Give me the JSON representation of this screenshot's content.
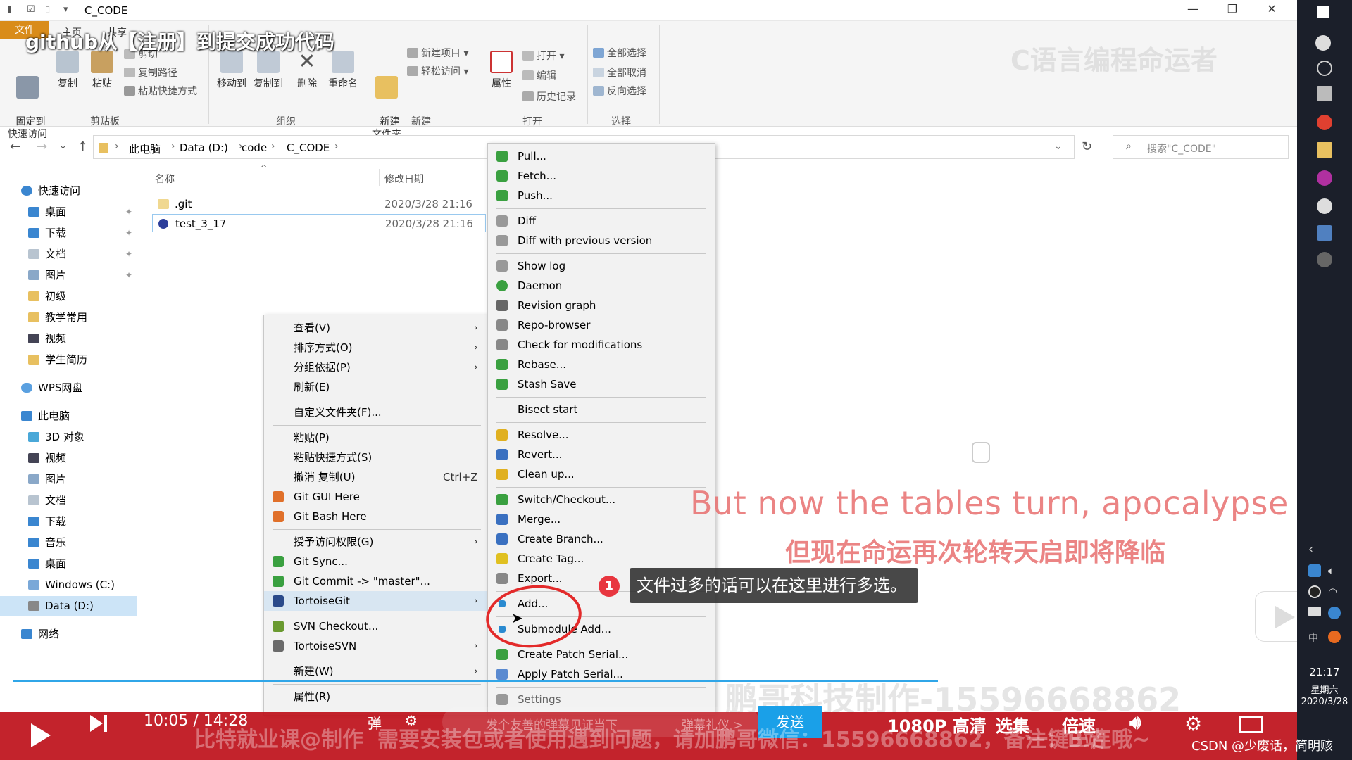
{
  "window": {
    "title": "C_CODE"
  },
  "video": {
    "title": "github从【注册】到提交成功代码",
    "watermark": "C语言编程命运者",
    "bg_watermark": "鹏哥科技制作-15596668862"
  },
  "ribbon": {
    "tabs": [
      "文件",
      "主页",
      "共享",
      "查看"
    ],
    "clipboard": {
      "pin": "固定到\n快速访问",
      "copy": "复制",
      "paste": "粘贴",
      "cut": "剪切",
      "copy_path": "复制路径",
      "paste_shortcut": "粘贴快捷方式",
      "label": "剪贴板"
    },
    "organize": {
      "move_to": "移动到",
      "copy_to": "复制到",
      "delete": "删除",
      "rename": "重命名",
      "label": "组织"
    },
    "new": {
      "new_folder": "新建\n文件夹",
      "new_item": "新建项目",
      "easy_access": "轻松访问",
      "label": "新建"
    },
    "open": {
      "properties": "属性",
      "open": "打开",
      "edit": "编辑",
      "history": "历史记录",
      "label": "打开"
    },
    "select": {
      "select_all": "全部选择",
      "select_none": "全部取消",
      "invert": "反向选择",
      "label": "选择"
    }
  },
  "address": {
    "crumbs": [
      "此电脑",
      "Data (D:)",
      "code",
      "C_CODE"
    ],
    "search_placeholder": "搜索\"C_CODE\""
  },
  "nav_pane": {
    "quick_access": "快速访问",
    "quick_items": [
      "桌面",
      "下载",
      "文档",
      "图片",
      "初级",
      "教学常用",
      "视频",
      "学生简历"
    ],
    "wps": "WPS网盘",
    "this_pc": "此电脑",
    "pc_items": [
      "3D 对象",
      "视频",
      "图片",
      "文档",
      "下载",
      "音乐",
      "桌面",
      "Windows (C:)",
      "Data (D:)"
    ],
    "network": "网络"
  },
  "file_list": {
    "col_name": "名称",
    "col_date": "修改日期",
    "rows": [
      {
        "name": ".git",
        "date": "2020/3/28 21:16"
      },
      {
        "name": "test_3_17",
        "date": "2020/3/28 21:16"
      }
    ]
  },
  "context_menu": {
    "items": [
      {
        "label": "查看(V)"
      },
      {
        "label": "排序方式(O)"
      },
      {
        "label": "分组依据(P)"
      },
      {
        "label": "刷新(E)"
      },
      {
        "label": "自定义文件夹(F)..."
      },
      {
        "label": "粘贴(P)"
      },
      {
        "label": "粘贴快捷方式(S)"
      },
      {
        "label": "撤消 复制(U)",
        "shortcut": "Ctrl+Z"
      },
      {
        "label": "Git GUI Here"
      },
      {
        "label": "Git Bash Here"
      },
      {
        "label": "授予访问权限(G)"
      },
      {
        "label": "Git Sync..."
      },
      {
        "label": "Git Commit -> \"master\"..."
      },
      {
        "label": "TortoiseGit"
      },
      {
        "label": "SVN Checkout..."
      },
      {
        "label": "TortoiseSVN"
      },
      {
        "label": "新建(W)"
      },
      {
        "label": "属性(R)"
      }
    ]
  },
  "tortoise_menu": {
    "items": [
      "Pull...",
      "Fetch...",
      "Push...",
      "Diff",
      "Diff with previous version",
      "Show log",
      "Daemon",
      "Revision graph",
      "Repo-browser",
      "Check for modifications",
      "Rebase...",
      "Stash Save",
      "Bisect start",
      "Resolve...",
      "Revert...",
      "Clean up...",
      "Switch/Checkout...",
      "Merge...",
      "Create Branch...",
      "Create Tag...",
      "Export...",
      "Add...",
      "Submodule Add...",
      "Create Patch Serial...",
      "Apply Patch Serial...",
      "Settings"
    ]
  },
  "subtitles": {
    "en": "But now the tables turn, apocalypse i",
    "zh": "但现在命运再次轮转天启即将降临"
  },
  "annotation": {
    "badge": "1",
    "text": "文件过多的话可以在这里进行多选。"
  },
  "taskbar": {
    "time": "21:17",
    "day": "星期六",
    "date": "2020/3/28"
  },
  "player": {
    "time": "10:05 / 14:28",
    "credit": "比特就业课@制作",
    "danmaku_placeholder": "发个友善的弹幕见证当下",
    "danmaku_etiquette": "弹幕礼仪 >",
    "send": "发送",
    "notice": "需要安装包或者使用遇到问题，请加鹏哥微信：15596668862，备注：B站",
    "quality": "1080P 高清",
    "episodes": "选集",
    "speed": "倍速",
    "triple": "一键三连哦~",
    "csdn": "CSDN @少废话，简明赅"
  },
  "colors": {
    "file_tab": "#d98c1a",
    "player_bar": "#be121c",
    "accent_blue": "#1aa0e8",
    "annotation_red": "#e32a2a"
  }
}
